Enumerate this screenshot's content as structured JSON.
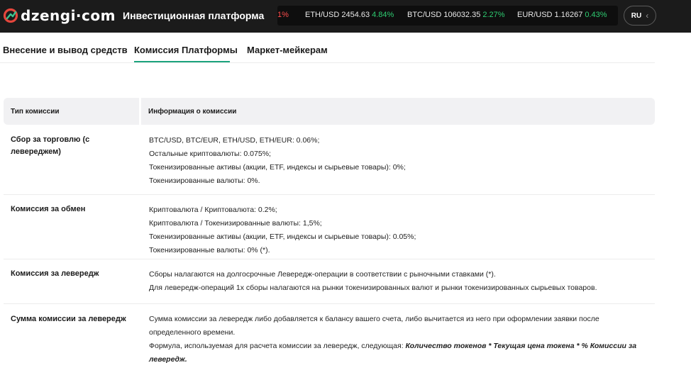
{
  "header": {
    "logo_text": "dzengi·com",
    "platform_title": "Инвестиционная платформа",
    "ticker": [
      {
        "pair": "",
        "change": "1%",
        "direction": "down"
      },
      {
        "pair": "ETH/USD 2454.63",
        "change": "4.84%",
        "direction": "up"
      },
      {
        "pair": "BTC/USD 106032.35",
        "change": "2.27%",
        "direction": "up"
      },
      {
        "pair": "EUR/USD 1.16267",
        "change": "0.43%",
        "direction": "up"
      }
    ],
    "language": "RU"
  },
  "tabs": [
    {
      "label": "Внесение и вывод средств"
    },
    {
      "label": "Комиссия Платформы",
      "active": true
    },
    {
      "label": "Маркет-мейкерам"
    }
  ],
  "table": {
    "headers": [
      "Тип комиссии",
      "Информация о комиссии"
    ],
    "rows": [
      {
        "type": "Сбор за торговлю (с левереджем)",
        "lines": [
          "BTC/USD, BTC/EUR, ETH/USD, ETH/EUR: 0.06%;",
          "Остальные криптовалюты: 0.075%;",
          "Токенизированные активы (акции, ETF, индексы и сырьевые товары): 0%;",
          "Токенизированные валюты: 0%."
        ]
      },
      {
        "type": "Комиссия за обмен",
        "lines": [
          "Криптовалюта / Криптовалюта: 0.2%;",
          "Криптовалюта / Токенизированные валюты: 1,5%;",
          "Токенизированные активы (акции, ETF, индексы и сырьевые товары): 0.05%;",
          "Токенизированные валюты: 0% (*)."
        ]
      },
      {
        "type": "Комиссия за левередж",
        "lines": [
          "Сборы налагаются на долгосрочные Левередж-операции в соответствии с рыночными ставками (*).",
          "Для левередж-операций 1х сборы налагаются на рынки токенизированных валют и рынки токенизированных сырьевых товаров."
        ]
      },
      {
        "type": "Сумма комиссии за левередж",
        "text_1": "Сумма комиссии за левередж либо добавляется к балансу вашего счета, либо вычитается из него при оформлении заявки после определенного времени.",
        "text_2": "Формула, используемая для расчета комиссии за левередж, следующая: ",
        "formula": "Количество токенов * Текущая цена токена  * % Комиссии за левередж."
      }
    ]
  },
  "colors": {
    "header_bg": "#1b1b1b",
    "accent_green": "#1ba37d",
    "change_up": "#2ecc71",
    "change_down": "#ff4d4d",
    "logo_red": "#e5463c"
  }
}
